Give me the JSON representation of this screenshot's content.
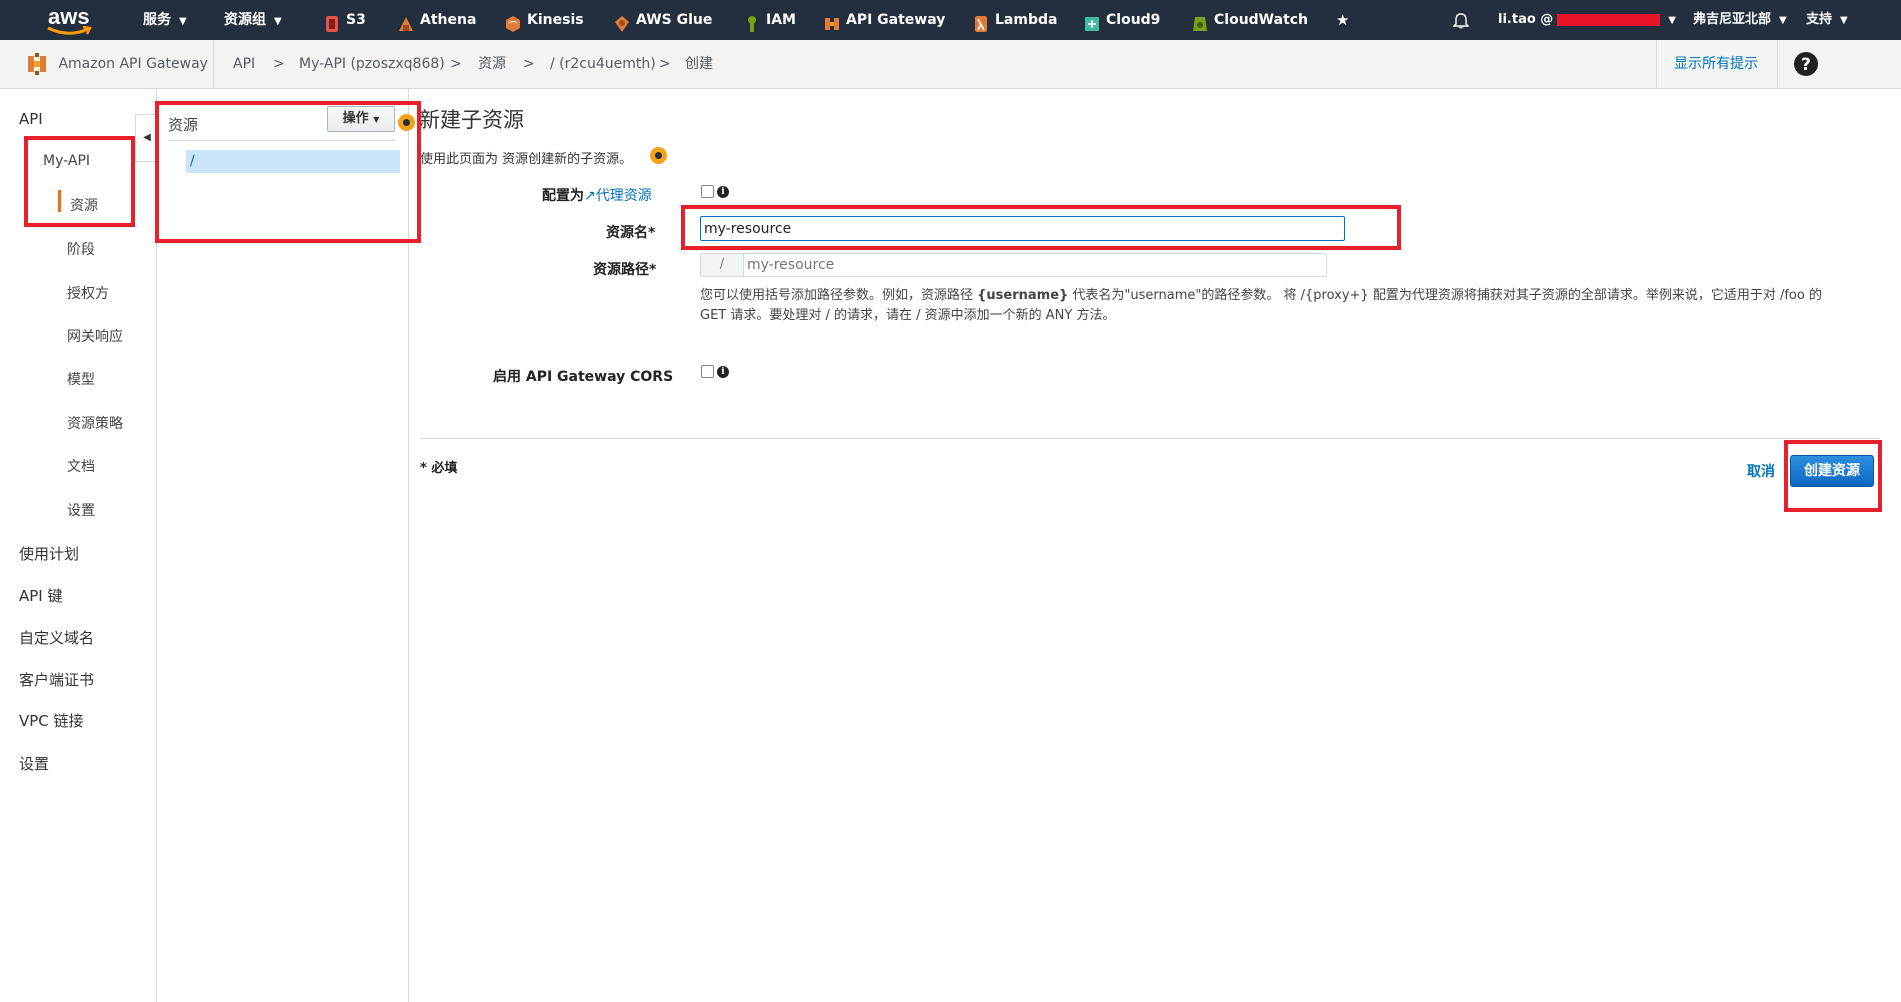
{
  "topnav": {
    "logo": "aws",
    "services": "服务",
    "resource_groups": "资源组",
    "shortcuts": [
      {
        "label": "S3",
        "icon": "s3-icon",
        "color": "#e25444"
      },
      {
        "label": "Athena",
        "icon": "athena-icon",
        "color": "#e07b39"
      },
      {
        "label": "Kinesis",
        "icon": "kinesis-icon",
        "color": "#e07b39"
      },
      {
        "label": "AWS Glue",
        "icon": "glue-icon",
        "color": "#e07b39"
      },
      {
        "label": "IAM",
        "icon": "iam-icon",
        "color": "#7aa116"
      },
      {
        "label": "API Gateway",
        "icon": "api-gateway-icon",
        "color": "#e07b39"
      },
      {
        "label": "Lambda",
        "icon": "lambda-icon",
        "color": "#e07b39"
      },
      {
        "label": "Cloud9",
        "icon": "cloud9-icon",
        "color": "#3fbc9b"
      },
      {
        "label": "CloudWatch",
        "icon": "cloudwatch-icon",
        "color": "#7aa116"
      }
    ],
    "user": "li.tao @",
    "region": "弗吉尼亚北部",
    "support": "支持"
  },
  "breadcrumb": {
    "service": "Amazon API Gateway",
    "items": [
      "API",
      "My-API (pzoszxq868)",
      "资源",
      "/ (r2cu4uemth)",
      "创建"
    ],
    "separator": ">",
    "show_tips": "显示所有提示"
  },
  "leftnav": {
    "api": "API",
    "api_name": "My-API",
    "sub_items": [
      "资源",
      "阶段",
      "授权方",
      "网关响应",
      "模型",
      "资源策略",
      "文档",
      "设置"
    ],
    "items": [
      "使用计划",
      "API 键",
      "自定义域名",
      "客户端证书",
      "VPC 链接",
      "设置"
    ]
  },
  "resources": {
    "title": "资源",
    "actions": "操作",
    "root": "/"
  },
  "form": {
    "heading": "新建子资源",
    "description": "使用此页面为 资源创建新的子资源。",
    "proxy_label_prefix": "配置为",
    "proxy_link": "代理资源",
    "proxy_checked": false,
    "name_label": "资源名*",
    "name_value": "my-resource",
    "path_label": "资源路径*",
    "path_prefix": "/",
    "path_placeholder": "my-resource",
    "help_line1_a": "您可以使用括号添加路径参数。例如，资源路径 ",
    "help_line1_bold": "{username}",
    "help_line1_b": " 代表名为\"username\"的路径参数。 将 /{proxy+} 配置为代理资源将捕获对其子资源的全部请求。举例来说，它适用于对 /foo 的",
    "help_line2": "GET 请求。要处理对 / 的请求，请在 / 资源中添加一个新的 ANY 方法。",
    "cors_label": "启用 API Gateway CORS",
    "cors_checked": false,
    "required_note": "* 必填",
    "cancel": "取消",
    "submit": "创建资源"
  },
  "colors": {
    "nav_bg": "#232f3e",
    "accent_orange": "#ec7211",
    "link_blue": "#0073bb",
    "highlight_red": "#e8202b",
    "primary_button": "#1067c2"
  }
}
